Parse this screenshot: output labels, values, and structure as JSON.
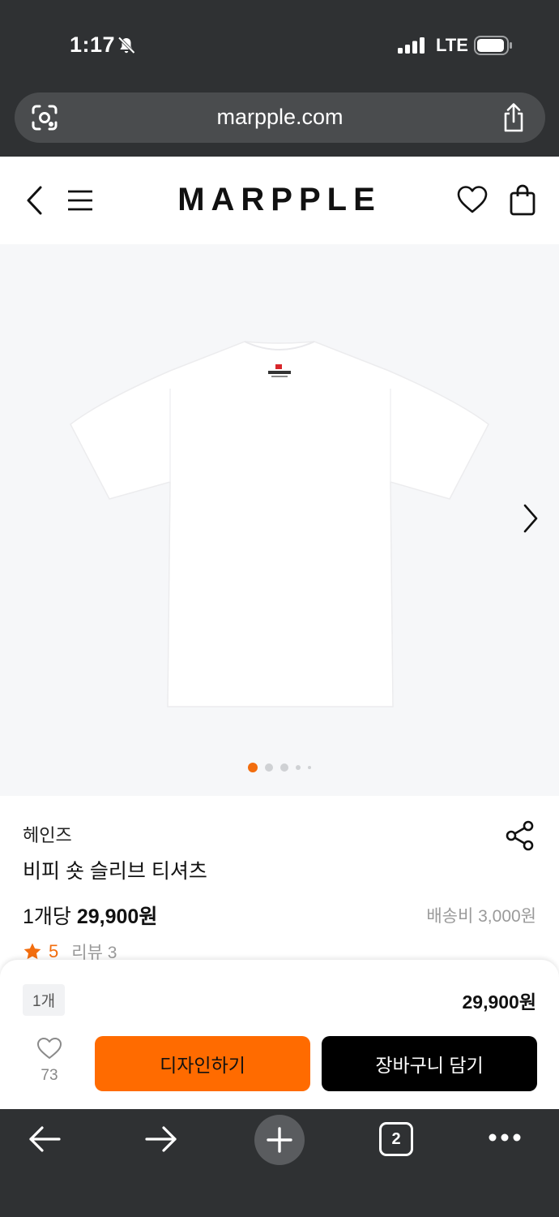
{
  "status_bar": {
    "time": "1:17",
    "network": "LTE"
  },
  "browser": {
    "url": "marpple.com",
    "tab_count": "2"
  },
  "site": {
    "logo": "MARPPLE"
  },
  "product": {
    "brand": "헤인즈",
    "name": "비피 숏 슬리브 티셔츠",
    "unit_prefix": "1개당",
    "price": "29,900원",
    "shipping": "배송비 3,000원",
    "rating": "5",
    "reviews": "리뷰 3",
    "image_page": 1,
    "image_total": 5
  },
  "order": {
    "quantity": "1개",
    "total": "29,900원",
    "likes": "73",
    "design_button": "디자인하기",
    "cart_button": "장바구니 담기"
  },
  "colors": {
    "accent": "#ff6b00",
    "chrome": "#2f3133",
    "image_bg": "#f6f7f9"
  }
}
